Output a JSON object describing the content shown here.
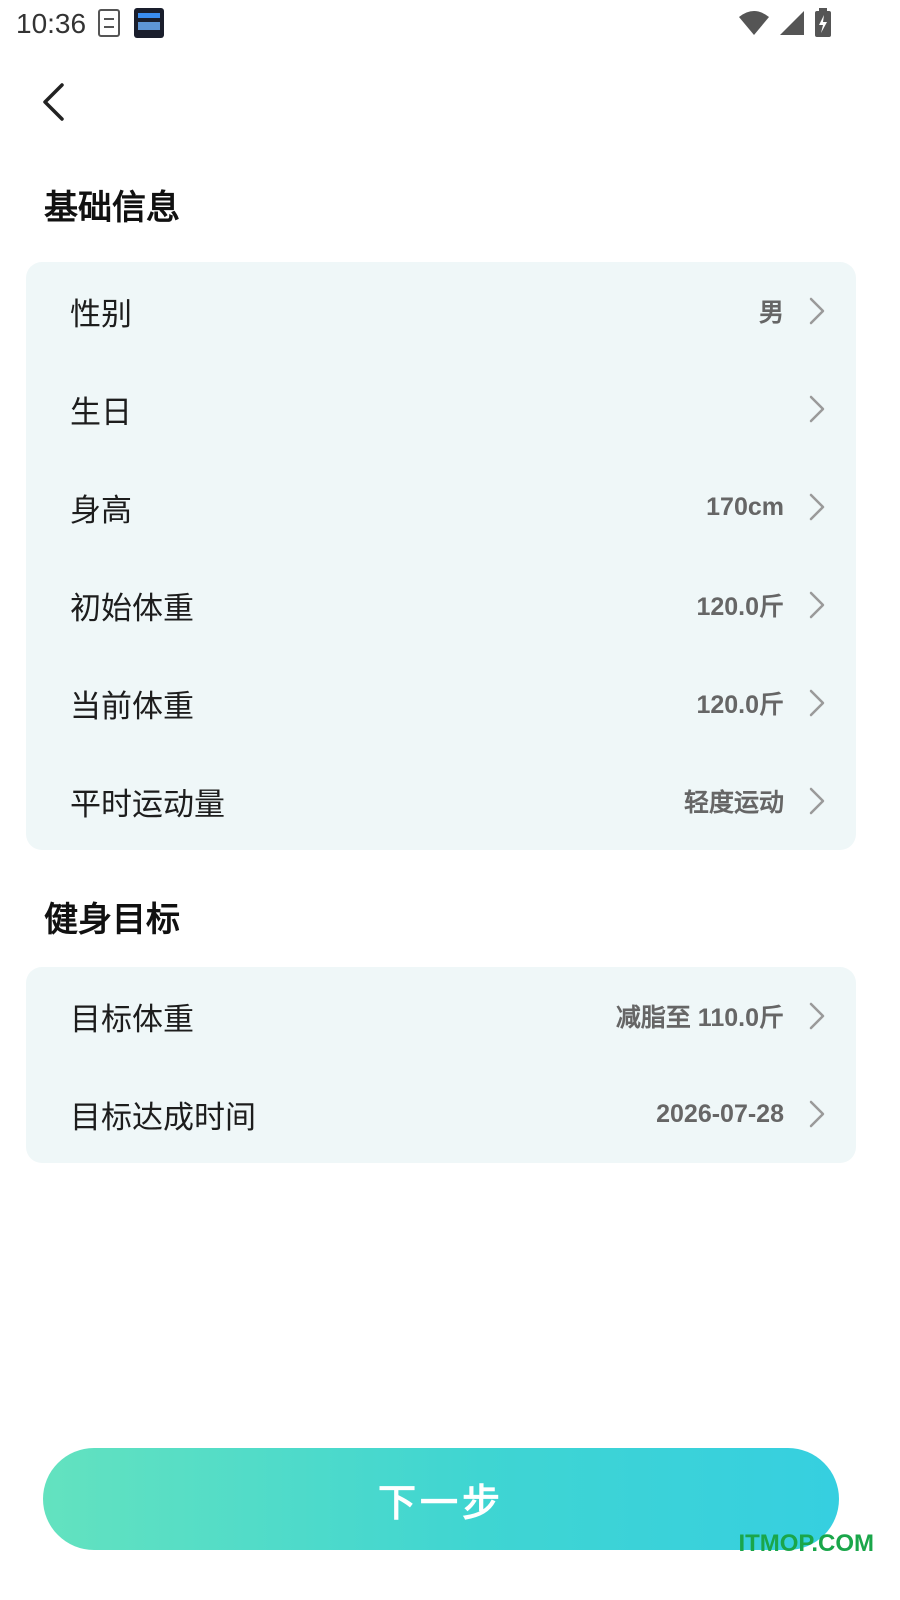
{
  "status_bar": {
    "time": "10:36",
    "icons": [
      "sim-card-icon",
      "clock-widget-icon",
      "wifi-icon",
      "signal-icon",
      "battery-charging-icon"
    ]
  },
  "header": {
    "back_icon": "chevron-left-icon"
  },
  "basic_info": {
    "title": "基础信息",
    "rows": [
      {
        "label": "性别",
        "value": "男"
      },
      {
        "label": "生日",
        "value": ""
      },
      {
        "label": "身高",
        "value": "170cm"
      },
      {
        "label": "初始体重",
        "value": "120.0斤"
      },
      {
        "label": "当前体重",
        "value": "120.0斤"
      },
      {
        "label": "平时运动量",
        "value": "轻度运动"
      }
    ]
  },
  "fitness_goal": {
    "title": "健身目标",
    "rows": [
      {
        "label": "目标体重",
        "value": "减脂至 110.0斤"
      },
      {
        "label": "目标达成时间",
        "value": "2026-07-28"
      }
    ]
  },
  "footer": {
    "next_label": "下一步"
  },
  "watermark": "ITMOP.COM",
  "colors": {
    "card_bg": "#eff7f8",
    "button_gradient_start": "#63e2bf",
    "button_gradient_end": "#36cfe0",
    "value_text": "#666666",
    "watermark": "#1aa64a"
  }
}
